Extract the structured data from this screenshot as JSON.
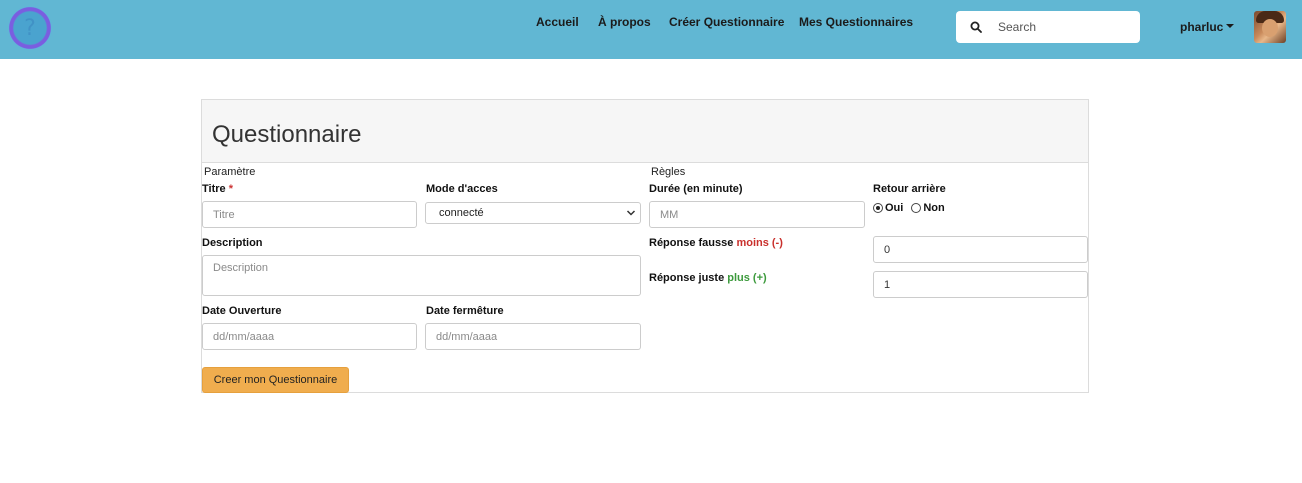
{
  "nav": {
    "links": [
      "Accueil",
      "À propos",
      "Créer Questionnaire",
      "Mes Questionnaires"
    ],
    "search_placeholder": "Search",
    "username": "pharluc"
  },
  "card": {
    "title": "Questionnaire",
    "left_section": "Paramètre",
    "right_section": "Règles",
    "titre": {
      "label": "Titre",
      "required_mark": "*",
      "placeholder": "Titre"
    },
    "mode": {
      "label": "Mode d'acces",
      "value": "connecté"
    },
    "description": {
      "label": "Description",
      "placeholder": "Description"
    },
    "date_ouverture": {
      "label": "Date Ouverture",
      "placeholder": "dd/mm/aaaa"
    },
    "date_fermeture": {
      "label": "Date fermêture",
      "placeholder": "dd/mm/aaaa"
    },
    "duree": {
      "label": "Durée (en minute)",
      "placeholder": "MM"
    },
    "retour": {
      "label": "Retour arrière",
      "options": [
        "Oui",
        "Non"
      ],
      "selected": "Oui"
    },
    "reponse_fausse": {
      "label": "Réponse fausse",
      "hint": "moins (-)",
      "value": "0"
    },
    "reponse_juste": {
      "label": "Réponse juste",
      "hint": "plus (+)",
      "value": "1"
    },
    "submit_label": "Creer mon Questionnaire"
  },
  "colors": {
    "navbar": "#61b7d3",
    "button": "#f0ad4e",
    "minus": "#c9302c",
    "plus": "#3c9a3c"
  }
}
